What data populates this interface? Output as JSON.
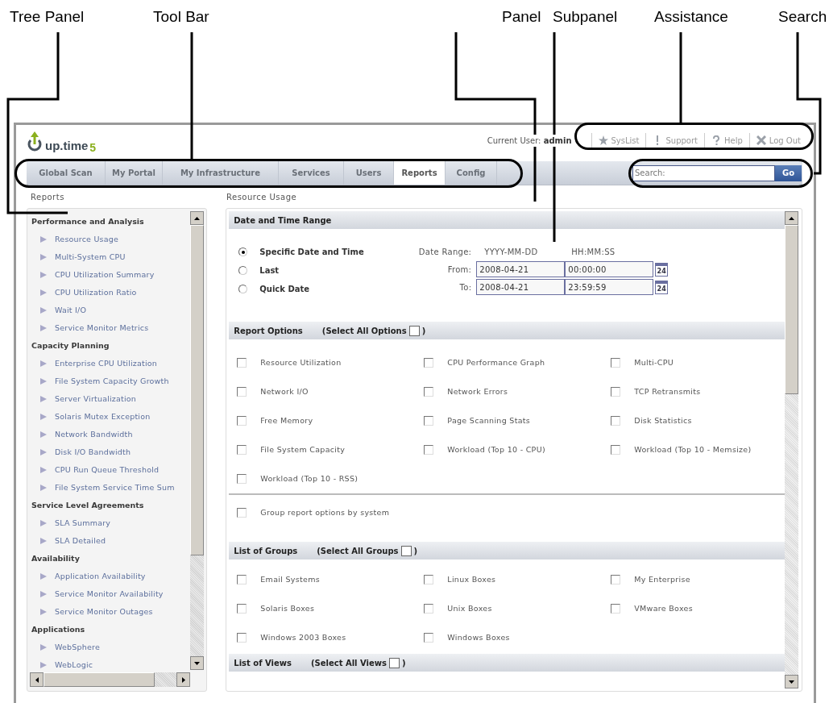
{
  "annotations": [
    {
      "label": "Tree Panel"
    },
    {
      "label": "Tool Bar"
    },
    {
      "label": "Panel"
    },
    {
      "label": "Subpanel"
    },
    {
      "label": "Assistance"
    },
    {
      "label": "Search"
    }
  ],
  "logo": {
    "name": "up.time",
    "version": "5"
  },
  "current_user": {
    "label": "Current User:",
    "name": "admin"
  },
  "assistance": [
    {
      "kind": "star",
      "label": "SysList"
    },
    {
      "kind": "exclaim",
      "label": "Support"
    },
    {
      "kind": "question",
      "label": "Help"
    },
    {
      "kind": "cross",
      "label": "Log Out"
    }
  ],
  "tabs": [
    {
      "label": "Global Scan",
      "selected": false
    },
    {
      "label": "My Portal",
      "selected": false
    },
    {
      "label": "My Infrastructure",
      "selected": false
    },
    {
      "label": "Services",
      "selected": false
    },
    {
      "label": "Users",
      "selected": false
    },
    {
      "label": "Reports",
      "selected": true
    },
    {
      "label": "Config",
      "selected": false
    }
  ],
  "search": {
    "placeholder": "Search:",
    "button": "Go"
  },
  "tree_title": "Reports",
  "panel_title": "Resource Usage",
  "tree": [
    {
      "label": "Performance and Analysis",
      "children": [
        {
          "label": "Resource Usage"
        },
        {
          "label": "Multi-System CPU"
        },
        {
          "label": "CPU Utilization Summary"
        },
        {
          "label": "CPU Utilization Ratio"
        },
        {
          "label": "Wait I/O"
        },
        {
          "label": "Service Monitor Metrics"
        }
      ]
    },
    {
      "label": "Capacity Planning",
      "children": [
        {
          "label": "Enterprise CPU Utilization"
        },
        {
          "label": "File System Capacity Growth"
        },
        {
          "label": "Server Virtualization"
        },
        {
          "label": "Solaris Mutex Exception"
        },
        {
          "label": "Network Bandwidth"
        },
        {
          "label": "Disk I/O Bandwidth"
        },
        {
          "label": "CPU Run Queue Threshold"
        },
        {
          "label": "File System Service Time Sum"
        }
      ]
    },
    {
      "label": "Service Level Agreements",
      "children": [
        {
          "label": "SLA Summary"
        },
        {
          "label": "SLA Detailed"
        }
      ]
    },
    {
      "label": "Availability",
      "children": [
        {
          "label": "Application Availability"
        },
        {
          "label": "Service Monitor Availability"
        },
        {
          "label": "Service Monitor Outages"
        }
      ]
    },
    {
      "label": "Applications",
      "children": [
        {
          "label": "WebSphere"
        },
        {
          "label": "WebLogic"
        }
      ]
    }
  ],
  "date_section": {
    "title": "Date and Time Range",
    "modes": [
      {
        "label": "Specific Date and Time",
        "selected": true
      },
      {
        "label": "Last",
        "selected": false
      },
      {
        "label": "Quick Date",
        "selected": false
      }
    ],
    "range_label": "Date Range:",
    "date_format": "YYYY-MM-DD",
    "time_format": "HH:MM:SS",
    "rows": [
      {
        "label": "From:",
        "date": "2008-04-21",
        "time": "00:00:00",
        "calendar": "24"
      },
      {
        "label": "To:",
        "date": "2008-04-21",
        "time": "23:59:59",
        "calendar": "24"
      }
    ]
  },
  "option_sections": [
    {
      "title": "Report Options",
      "select_all": "(Select All Options",
      "close": ")",
      "select_all_checked": false,
      "options": [
        {
          "label": "Resource Utilization",
          "checked": false
        },
        {
          "label": "CPU Performance Graph",
          "checked": false
        },
        {
          "label": "Multi-CPU",
          "checked": false
        },
        {
          "label": "Network I/O",
          "checked": false
        },
        {
          "label": "Network Errors",
          "checked": false
        },
        {
          "label": "TCP Retransmits",
          "checked": false
        },
        {
          "label": "Free Memory",
          "checked": false
        },
        {
          "label": "Page Scanning Stats",
          "checked": false
        },
        {
          "label": "Disk Statistics",
          "checked": false
        },
        {
          "label": "File System Capacity",
          "checked": false
        },
        {
          "label": "Workload (Top 10 - CPU)",
          "checked": false
        },
        {
          "label": "Workload (Top 10 - Memsize)",
          "checked": false
        },
        {
          "label": "Workload (Top 10 - RSS)",
          "checked": false
        }
      ],
      "extra": {
        "label": "Group report options by system",
        "checked": false
      }
    },
    {
      "title": "List of Groups",
      "select_all": "(Select All Groups",
      "close": ")",
      "select_all_checked": false,
      "options": [
        {
          "label": "Email Systems",
          "checked": false
        },
        {
          "label": "Linux Boxes",
          "checked": false
        },
        {
          "label": "My Enterprise",
          "checked": false
        },
        {
          "label": "Solaris Boxes",
          "checked": false
        },
        {
          "label": "Unix Boxes",
          "checked": false
        },
        {
          "label": "VMware Boxes",
          "checked": false
        },
        {
          "label": "Windows 2003 Boxes",
          "checked": false
        },
        {
          "label": "Windows Boxes",
          "checked": false
        }
      ]
    },
    {
      "title": "List of Views",
      "select_all": "(Select All Views",
      "close": ")",
      "select_all_checked": false
    }
  ]
}
